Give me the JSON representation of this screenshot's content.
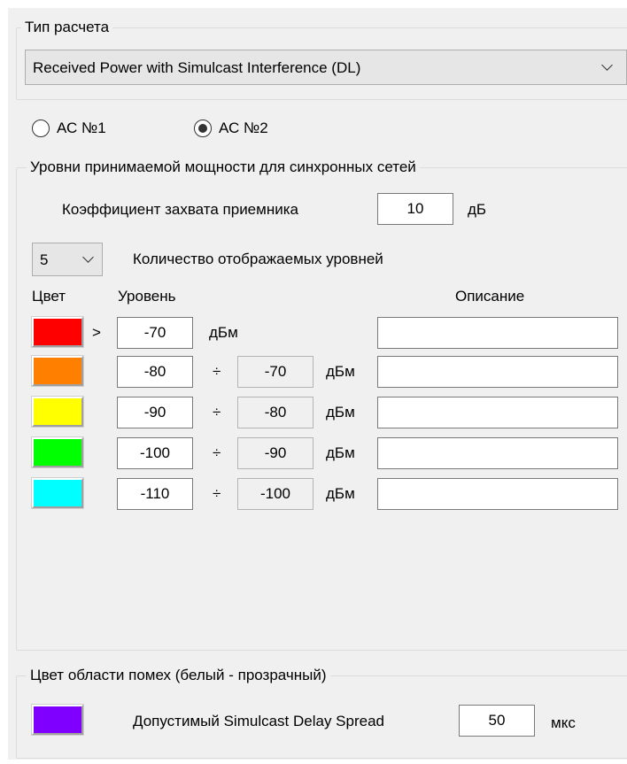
{
  "calc": {
    "legend": "Тип расчета",
    "selected": "Received Power with Simulcast Interference (DL)"
  },
  "radios": [
    {
      "label": "АС №1",
      "checked": false
    },
    {
      "label": "АС №2",
      "checked": true
    }
  ],
  "levels": {
    "legend": "Уровни принимаемой мощности для синхронных сетей",
    "capture_label": "Коэффициент захвата приемника",
    "capture_value": "10",
    "capture_unit": "дБ",
    "count_value": "5",
    "count_label": "Количество отображаемых уровней",
    "col_color": "Цвет",
    "col_level": "Уровень",
    "col_desc": "Описание",
    "rows": [
      {
        "color": "#ff0000",
        "op": ">",
        "low": "-70",
        "high": "",
        "unit": "дБм",
        "desc": ""
      },
      {
        "color": "#ff8000",
        "op": "÷",
        "low": "-80",
        "high": "-70",
        "unit": "дБм",
        "desc": ""
      },
      {
        "color": "#ffff00",
        "op": "÷",
        "low": "-90",
        "high": "-80",
        "unit": "дБм",
        "desc": ""
      },
      {
        "color": "#00ff00",
        "op": "÷",
        "low": "-100",
        "high": "-90",
        "unit": "дБм",
        "desc": ""
      },
      {
        "color": "#00ffff",
        "op": "÷",
        "low": "-110",
        "high": "-100",
        "unit": "дБм",
        "desc": ""
      }
    ]
  },
  "interference": {
    "legend": "Цвет области помех (белый - прозрачный)",
    "color": "#8000ff",
    "delay_label": "Допустимый Simulcast Delay Spread",
    "delay_value": "50",
    "delay_unit": "мкс"
  }
}
